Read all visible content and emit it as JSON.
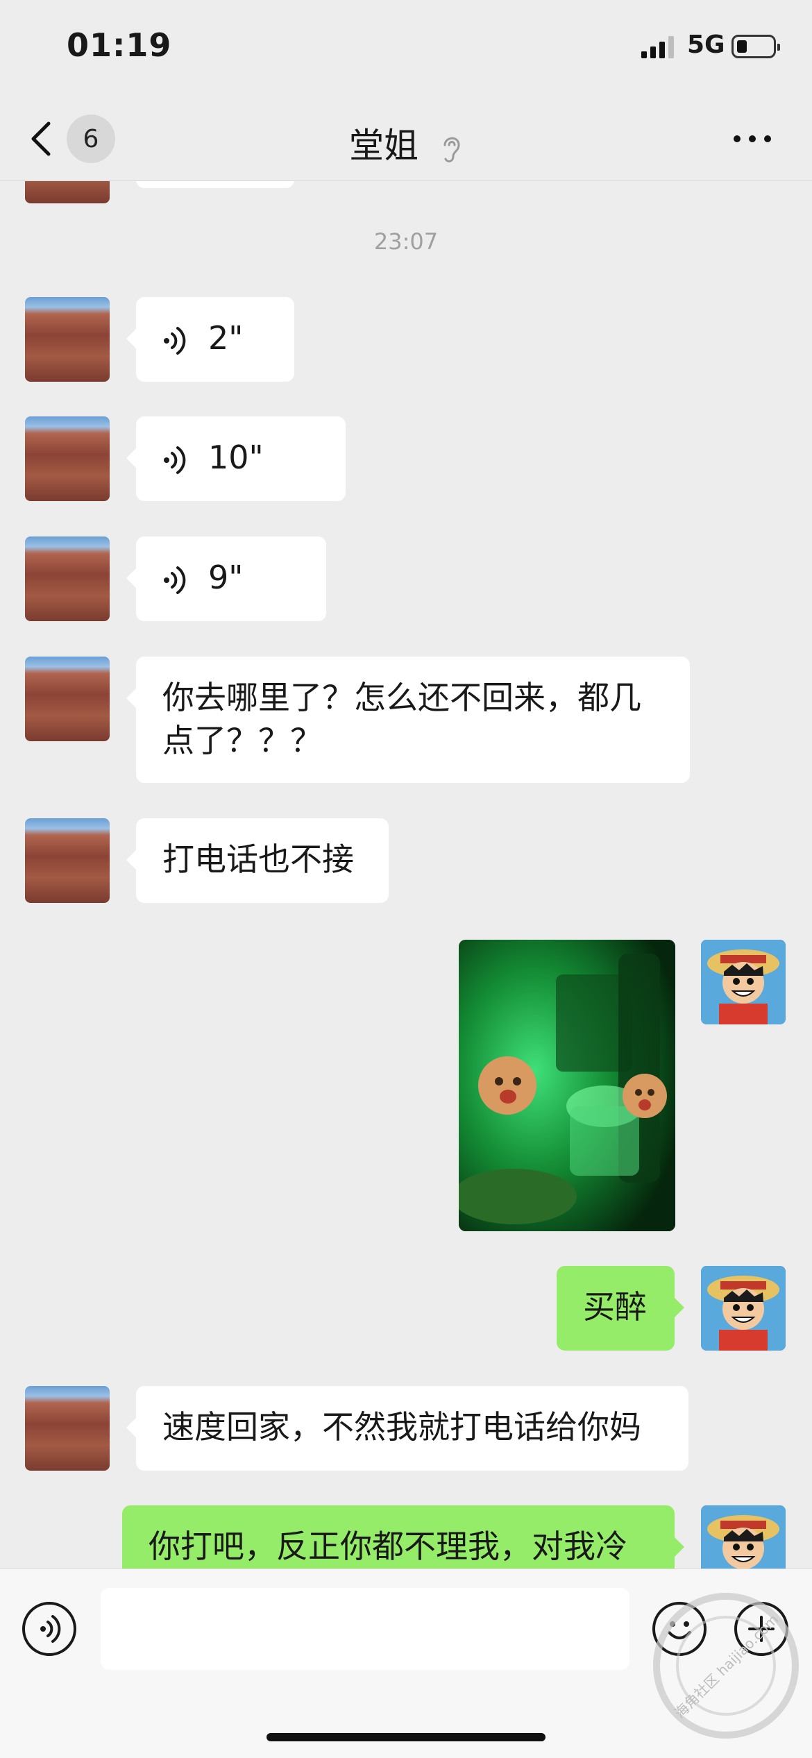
{
  "status_bar": {
    "time": "01:19",
    "network": "5G"
  },
  "header": {
    "unread_count": "6",
    "title": "堂姐"
  },
  "chat": {
    "timestamp": "23:07",
    "voice_messages": [
      {
        "duration": "2\""
      },
      {
        "duration": "10\""
      },
      {
        "duration": "9\""
      }
    ],
    "text_messages": [
      {
        "line1": "你去哪里了？怎么还不回来，都几",
        "line2": "点了？？？"
      },
      {
        "text": "打电话也不接"
      }
    ],
    "self_reply": "买醉",
    "threat": "速度回家，不然我就打电话给你妈",
    "last_reply": "你打吧，反正你都不理我，对我冷"
  },
  "watermark": {
    "text": "海角社区 haijiao.com"
  },
  "colors": {
    "background": "#ededed",
    "self_bubble": "#95ec69",
    "other_bubble": "#ffffff"
  },
  "icons": [
    "back-chevron-icon",
    "ear-icon",
    "more-icon",
    "voice-icon",
    "emoji-icon",
    "plus-icon"
  ]
}
